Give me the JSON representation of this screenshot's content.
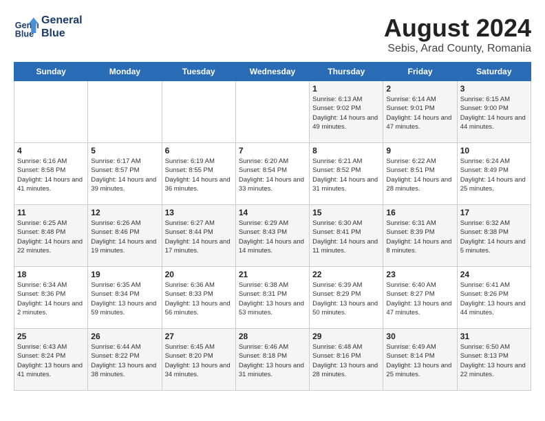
{
  "header": {
    "logo_line1": "General",
    "logo_line2": "Blue",
    "title": "August 2024",
    "subtitle": "Sebis, Arad County, Romania"
  },
  "days_of_week": [
    "Sunday",
    "Monday",
    "Tuesday",
    "Wednesday",
    "Thursday",
    "Friday",
    "Saturday"
  ],
  "weeks": [
    [
      {
        "day": "",
        "info": ""
      },
      {
        "day": "",
        "info": ""
      },
      {
        "day": "",
        "info": ""
      },
      {
        "day": "",
        "info": ""
      },
      {
        "day": "1",
        "info": "Sunrise: 6:13 AM\nSunset: 9:02 PM\nDaylight: 14 hours and 49 minutes."
      },
      {
        "day": "2",
        "info": "Sunrise: 6:14 AM\nSunset: 9:01 PM\nDaylight: 14 hours and 47 minutes."
      },
      {
        "day": "3",
        "info": "Sunrise: 6:15 AM\nSunset: 9:00 PM\nDaylight: 14 hours and 44 minutes."
      }
    ],
    [
      {
        "day": "4",
        "info": "Sunrise: 6:16 AM\nSunset: 8:58 PM\nDaylight: 14 hours and 41 minutes."
      },
      {
        "day": "5",
        "info": "Sunrise: 6:17 AM\nSunset: 8:57 PM\nDaylight: 14 hours and 39 minutes."
      },
      {
        "day": "6",
        "info": "Sunrise: 6:19 AM\nSunset: 8:55 PM\nDaylight: 14 hours and 36 minutes."
      },
      {
        "day": "7",
        "info": "Sunrise: 6:20 AM\nSunset: 8:54 PM\nDaylight: 14 hours and 33 minutes."
      },
      {
        "day": "8",
        "info": "Sunrise: 6:21 AM\nSunset: 8:52 PM\nDaylight: 14 hours and 31 minutes."
      },
      {
        "day": "9",
        "info": "Sunrise: 6:22 AM\nSunset: 8:51 PM\nDaylight: 14 hours and 28 minutes."
      },
      {
        "day": "10",
        "info": "Sunrise: 6:24 AM\nSunset: 8:49 PM\nDaylight: 14 hours and 25 minutes."
      }
    ],
    [
      {
        "day": "11",
        "info": "Sunrise: 6:25 AM\nSunset: 8:48 PM\nDaylight: 14 hours and 22 minutes."
      },
      {
        "day": "12",
        "info": "Sunrise: 6:26 AM\nSunset: 8:46 PM\nDaylight: 14 hours and 19 minutes."
      },
      {
        "day": "13",
        "info": "Sunrise: 6:27 AM\nSunset: 8:44 PM\nDaylight: 14 hours and 17 minutes."
      },
      {
        "day": "14",
        "info": "Sunrise: 6:29 AM\nSunset: 8:43 PM\nDaylight: 14 hours and 14 minutes."
      },
      {
        "day": "15",
        "info": "Sunrise: 6:30 AM\nSunset: 8:41 PM\nDaylight: 14 hours and 11 minutes."
      },
      {
        "day": "16",
        "info": "Sunrise: 6:31 AM\nSunset: 8:39 PM\nDaylight: 14 hours and 8 minutes."
      },
      {
        "day": "17",
        "info": "Sunrise: 6:32 AM\nSunset: 8:38 PM\nDaylight: 14 hours and 5 minutes."
      }
    ],
    [
      {
        "day": "18",
        "info": "Sunrise: 6:34 AM\nSunset: 8:36 PM\nDaylight: 14 hours and 2 minutes."
      },
      {
        "day": "19",
        "info": "Sunrise: 6:35 AM\nSunset: 8:34 PM\nDaylight: 13 hours and 59 minutes."
      },
      {
        "day": "20",
        "info": "Sunrise: 6:36 AM\nSunset: 8:33 PM\nDaylight: 13 hours and 56 minutes."
      },
      {
        "day": "21",
        "info": "Sunrise: 6:38 AM\nSunset: 8:31 PM\nDaylight: 13 hours and 53 minutes."
      },
      {
        "day": "22",
        "info": "Sunrise: 6:39 AM\nSunset: 8:29 PM\nDaylight: 13 hours and 50 minutes."
      },
      {
        "day": "23",
        "info": "Sunrise: 6:40 AM\nSunset: 8:27 PM\nDaylight: 13 hours and 47 minutes."
      },
      {
        "day": "24",
        "info": "Sunrise: 6:41 AM\nSunset: 8:26 PM\nDaylight: 13 hours and 44 minutes."
      }
    ],
    [
      {
        "day": "25",
        "info": "Sunrise: 6:43 AM\nSunset: 8:24 PM\nDaylight: 13 hours and 41 minutes."
      },
      {
        "day": "26",
        "info": "Sunrise: 6:44 AM\nSunset: 8:22 PM\nDaylight: 13 hours and 38 minutes."
      },
      {
        "day": "27",
        "info": "Sunrise: 6:45 AM\nSunset: 8:20 PM\nDaylight: 13 hours and 34 minutes."
      },
      {
        "day": "28",
        "info": "Sunrise: 6:46 AM\nSunset: 8:18 PM\nDaylight: 13 hours and 31 minutes."
      },
      {
        "day": "29",
        "info": "Sunrise: 6:48 AM\nSunset: 8:16 PM\nDaylight: 13 hours and 28 minutes."
      },
      {
        "day": "30",
        "info": "Sunrise: 6:49 AM\nSunset: 8:14 PM\nDaylight: 13 hours and 25 minutes."
      },
      {
        "day": "31",
        "info": "Sunrise: 6:50 AM\nSunset: 8:13 PM\nDaylight: 13 hours and 22 minutes."
      }
    ]
  ]
}
